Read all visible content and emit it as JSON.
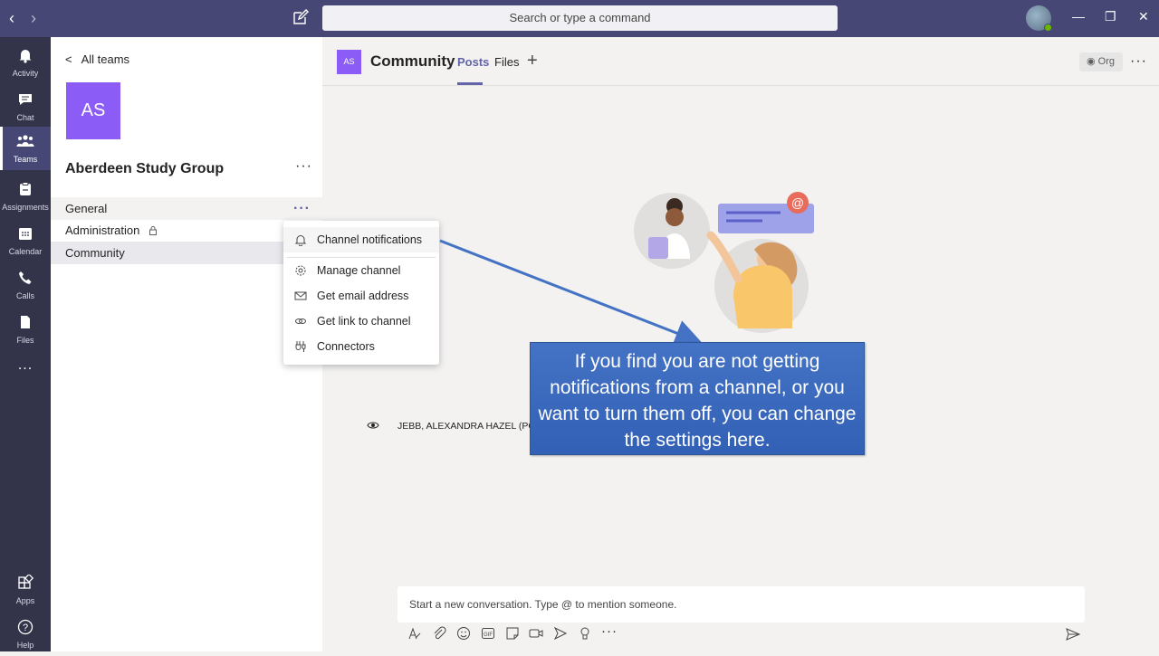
{
  "search": {
    "placeholder": "Search or type a command"
  },
  "rail": {
    "items": [
      {
        "label": "Activity",
        "icon": "bell-icon"
      },
      {
        "label": "Chat",
        "icon": "chat-icon"
      },
      {
        "label": "Teams",
        "icon": "teams-icon"
      },
      {
        "label": "Assignments",
        "icon": "assignments-icon"
      },
      {
        "label": "Calendar",
        "icon": "calendar-icon"
      },
      {
        "label": "Calls",
        "icon": "phone-icon"
      },
      {
        "label": "Files",
        "icon": "file-icon"
      }
    ],
    "more": "...",
    "apps": "Apps",
    "help": "Help"
  },
  "team_panel": {
    "back_label": "All teams",
    "avatar_initials": "AS",
    "team_name": "Aberdeen Study Group",
    "channels": [
      "General",
      "Administration",
      "Community"
    ]
  },
  "context_menu": {
    "items": [
      "Channel notifications",
      "Manage channel",
      "Get email address",
      "Get link to channel",
      "Connectors"
    ]
  },
  "channel_header": {
    "avatar_initials": "AS",
    "title": "Community",
    "tabs": [
      "Posts",
      "Files"
    ],
    "org_label": "Org"
  },
  "member": {
    "name": "JEBB, ALEXANDRA HAZEL (PGR)"
  },
  "callout": {
    "text": "If you find you are not getting notifications from a channel, or you want to turn them off, you can change the settings here."
  },
  "composer": {
    "placeholder": "Start a new conversation. Type @ to mention someone."
  },
  "colors": {
    "accent": "#6264a7",
    "top_bar": "#464775",
    "rail": "#33344a",
    "team_avatar": "#8b5cf6",
    "callout": "#4472c4"
  }
}
